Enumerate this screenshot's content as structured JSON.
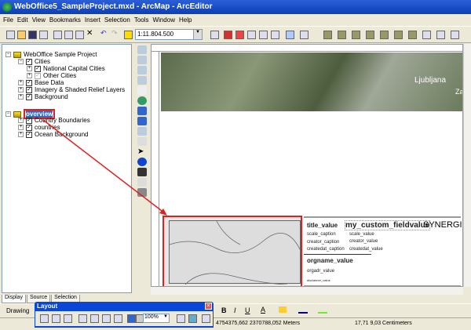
{
  "window": {
    "title": "WebOffice5_SampleProject.mxd - ArcMap - ArcEditor"
  },
  "menu": [
    "File",
    "Edit",
    "View",
    "Bookmarks",
    "Insert",
    "Selection",
    "Tools",
    "Window",
    "Help"
  ],
  "toolbar": {
    "scale": "1:11.804.500"
  },
  "toc": {
    "frame1": "WebOffice Sample Project",
    "cities": "Cities",
    "national": "National Capital Cities",
    "other": "Other Cities",
    "base": "Base Data",
    "imagery": "Imagery & Shaded Relief Layers",
    "background": "Background",
    "frame2": "overview",
    "country_boundaries": "Country Boundaries",
    "countries": "countries",
    "ocean": "Ocean Background"
  },
  "tabs": [
    "Display",
    "Source",
    "Selection"
  ],
  "map": {
    "city1": "Ljubljana",
    "city2": "Zag"
  },
  "legend": {
    "title": "title_value",
    "custom": "my_custom_fieldvalue",
    "logo": "SYNERGIS",
    "scale_caption": "scale_caption",
    "scale_value": "scale_value",
    "creator_caption": "creator_caption",
    "creator_value": "creator_value",
    "createdat_caption": "createdat_caption",
    "createdat_value": "createdat_value",
    "orgname": "orgname_value",
    "orgadr": "orgadr_value",
    "disclaimer": "disclaimer_value"
  },
  "drawing": {
    "label": "Drawing"
  },
  "layout_toolbar": {
    "title": "Layout",
    "zoom": "100%"
  },
  "status": {
    "coords": "4754375,662  2370788,052 Meters",
    "page": "17,71  9,03 Centimeters"
  }
}
